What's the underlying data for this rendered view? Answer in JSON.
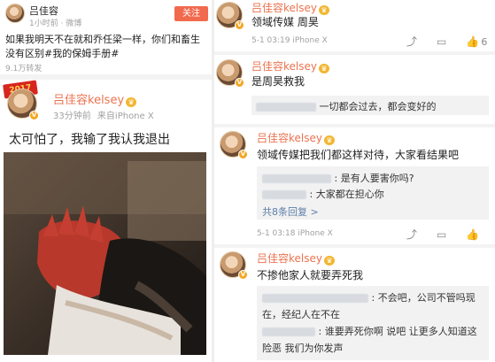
{
  "left": {
    "header": {
      "name": "吕佳容",
      "meta": "1小时前 · 微博",
      "follow_label": "关注"
    },
    "post_text_line1": "如果我明天不在就和乔任梁一样，你们和畜生",
    "post_text_line2": "没有区别#我的保姆手册#",
    "stat": "9.1万转发",
    "badge_year": "2017",
    "card": {
      "name": "吕佳容kelsey",
      "time": "33分钟前",
      "source": "来自iPhone X",
      "text": "太可怕了，我输了我认我退出"
    }
  },
  "right": {
    "item1": {
      "name": "吕佳容kelsey",
      "text": "领域传媒 周昊",
      "meta": "5-1 03:19  iPhone X",
      "likes": "6"
    },
    "item2": {
      "name": "吕佳容kelsey",
      "text": "是周昊救我",
      "reply": "一切都会过去，都会变好的"
    },
    "item3": {
      "name": "吕佳容kelsey",
      "text": "领域传媒把我们都这样对待，大家看结果吧",
      "reply1": ": 是有人要害你吗?",
      "reply2": ": 大家都在担心你",
      "reply_count": "共8条回复 >",
      "meta": "5-1 03:18  iPhone X"
    },
    "item4": {
      "name": "吕佳容kelsey",
      "text": "不掺他家人就要弄死我",
      "reply1_a": ": 不会吧，公司不管吗现",
      "reply1_b": "在，经纪人在不在",
      "reply2_a": ": 谁要弄死你啊   说吧   让更多人知道这",
      "reply2_b": "险恶  我们为你发声"
    }
  },
  "icons": [
    "share-icon",
    "comment-icon",
    "like-icon"
  ],
  "colors": {
    "accent": "#eb7350",
    "follow": "#f16a4e",
    "link": "#5d7fa8",
    "vip": "#f2b630"
  }
}
